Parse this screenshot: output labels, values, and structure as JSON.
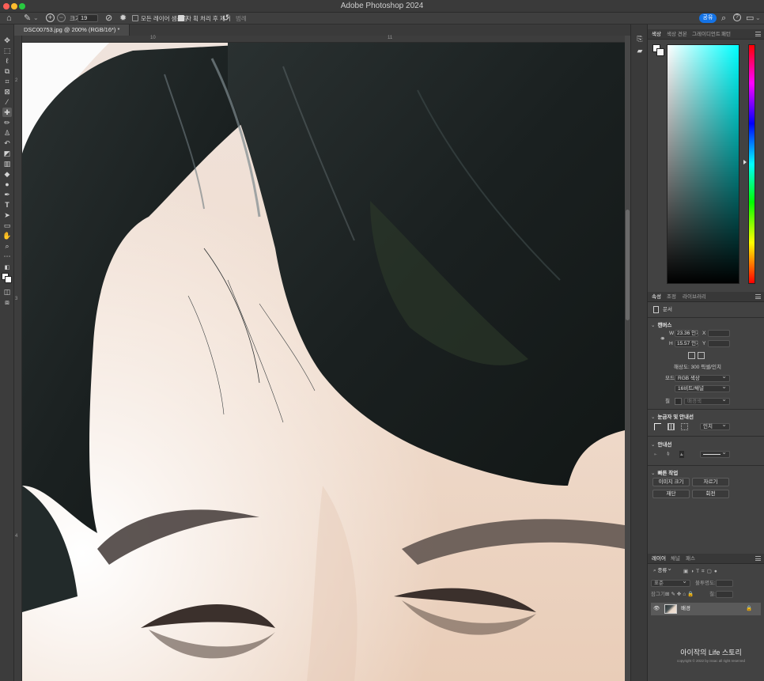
{
  "app": {
    "window_title": "Adobe Photoshop 2024",
    "colors": {
      "close": "#ff5f57",
      "minimize": "#febc2e",
      "maximize": "#28c840",
      "accent": "#1473e6"
    }
  },
  "options_bar": {
    "size_label": "크기:",
    "size_value": "19",
    "sample_all_layers": "모든 레이어 샘플링",
    "auto_enhance": "자 획 처리 후 제거",
    "note_label": "범례",
    "share_label": "공유",
    "icons": [
      "home-icon",
      "quick-select-icon",
      "add-to-selection-icon",
      "subtract-icon",
      "brush-settings-icon",
      "gear-icon",
      "refresh-icon",
      "search-icon",
      "help-icon",
      "workspace-icon"
    ]
  },
  "document": {
    "tab_title": "DSC00753.jpg @ 200% (RGB/16*) *"
  },
  "rulers": {
    "h_ticks": [
      "10",
      "11"
    ],
    "v_ticks": [
      "2",
      "3",
      "4"
    ]
  },
  "color_panel": {
    "tabs": [
      "색상",
      "색상 견본",
      "그레이디언트",
      "패턴"
    ],
    "active_tab": 0,
    "selected_hue": "#00ffff"
  },
  "properties_panel": {
    "tabs": [
      "속성",
      "조정",
      "라이브러리"
    ],
    "active_tab": 0,
    "doc_label": "문서",
    "canvas": {
      "header": "캔버스",
      "w_label": "W",
      "w_value": "23.36 인치",
      "h_label": "H",
      "h_value": "15.57 인치",
      "x_label": "X",
      "y_label": "Y",
      "resolution": "해상도: 300 픽셀/인치",
      "mode_label": "모드",
      "mode_value": "RGB 색상",
      "depth_value": "16비트/채널",
      "fill_label": "칠",
      "fill_value": "배경색"
    },
    "rulers_grids": {
      "header": "눈금자 및 안내선",
      "unit": "인치"
    },
    "guides": {
      "header": "안내선"
    },
    "quick_actions": {
      "header": "빠른 작업",
      "image_size": "이미지 크기",
      "crop": "자르기",
      "trim": "재단",
      "rotate": "회전"
    }
  },
  "layers_panel": {
    "tabs": [
      "레이어",
      "채널",
      "패스"
    ],
    "active_tab": 0,
    "filter_label": "종류",
    "blend_mode": "표준",
    "opacity_label": "불투명도:",
    "lock_label": "잠그기:",
    "fill_label": "칠:",
    "layers": [
      {
        "name": "배경",
        "visible": true,
        "locked": true
      }
    ]
  },
  "watermark": {
    "line1": "아이작의 Life 스토리",
    "line2": "copyright © 2022 by issac all right reserved"
  }
}
